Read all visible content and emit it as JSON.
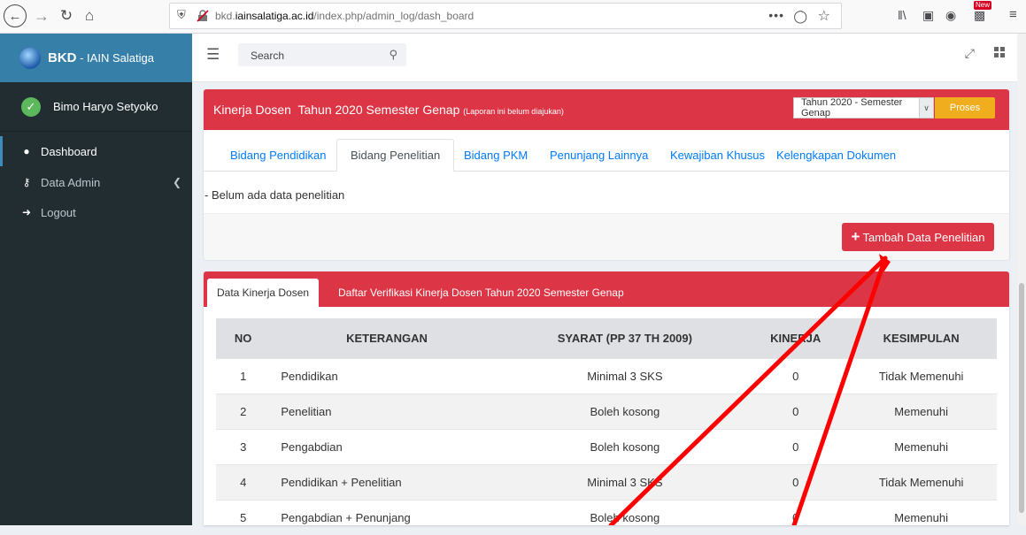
{
  "browser": {
    "url_prefix": "bkd.",
    "url_host": "iainsalatiga.ac.id",
    "url_path": "/index.php/admin_log/dash_board",
    "more_label": "•••",
    "new_badge": "New"
  },
  "sidebar": {
    "brand_bold": "BKD",
    "brand_rest": " - IAIN Salatiga",
    "user_name": "Bimo Haryo Setyoko",
    "items": [
      {
        "label": "Dashboard",
        "icon": "dashboard-icon"
      },
      {
        "label": "Data Admin",
        "icon": "key-icon"
      },
      {
        "label": "Logout",
        "icon": "sign-out-icon"
      }
    ]
  },
  "topnav": {
    "search_placeholder": "Search"
  },
  "panel": {
    "title": "Kinerja Dosen  Tahun 2020 Semester Genap",
    "title_note": "(Laporan ini belum diajukan)",
    "period_value": "Tahun 2020 - Semester Genap",
    "proses_label": "Proses",
    "tabs": [
      "Bidang Pendidikan",
      "Bidang Penelitian",
      "Bidang PKM",
      "Penunjang Lainnya",
      "Kewajiban Khusus",
      "Kelengkapan Dokumen"
    ],
    "active_tab": "Bidang Penelitian",
    "empty_message": "- Belum ada data penelitian",
    "add_button": "Tambah Data Penelitian"
  },
  "summary": {
    "tabs": [
      "Data Kinerja Dosen",
      "Daftar Verifikasi Kinerja Dosen Tahun 2020 Semester Genap"
    ],
    "headers": [
      "NO",
      "KETERANGAN",
      "SYARAT (PP 37 TH 2009)",
      "KINERJA",
      "KESIMPULAN"
    ],
    "rows": [
      {
        "no": "1",
        "keterangan": "Pendidikan",
        "syarat": "Minimal 3 SKS",
        "kinerja": "0",
        "kesimpulan": "Tidak Memenuhi"
      },
      {
        "no": "2",
        "keterangan": "Penelitian",
        "syarat": "Boleh kosong",
        "kinerja": "0",
        "kesimpulan": "Memenuhi"
      },
      {
        "no": "3",
        "keterangan": "Pengabdian",
        "syarat": "Boleh kosong",
        "kinerja": "0",
        "kesimpulan": "Memenuhi"
      },
      {
        "no": "4",
        "keterangan": "Pendidikan + Penelitian",
        "syarat": "Minimal 3 SKS",
        "kinerja": "0",
        "kesimpulan": "Tidak Memenuhi"
      },
      {
        "no": "5",
        "keterangan": "Pengabdian + Penunjang",
        "syarat": "Boleh kosong",
        "kinerja": "0",
        "kesimpulan": "Memenuhi"
      }
    ]
  },
  "colors": {
    "sidebar_bg": "#222d32",
    "brand_bg": "#367fa9",
    "header_red": "#dc3545",
    "proses_yellow": "#f0ad1e",
    "annotation_red": "#ff0000"
  }
}
